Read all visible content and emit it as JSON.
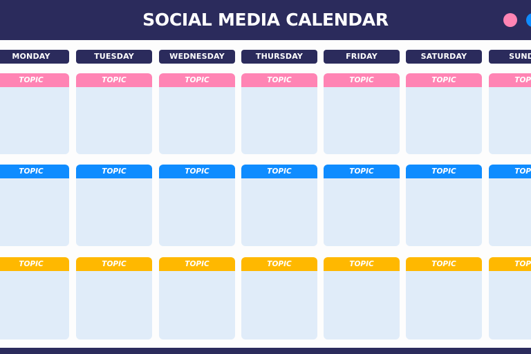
{
  "header": {
    "title": "SOCIAL MEDIA CALENDAR",
    "dots": [
      {
        "name": "pink-dot",
        "color": "#ff84b4"
      },
      {
        "name": "blue-dot",
        "color": "#0f8cff"
      }
    ]
  },
  "colors": {
    "navy": "#2b2b5c",
    "card": "#e0ecf9",
    "pink": "#ff84b4",
    "blue": "#0f8cff",
    "yellow": "#ffb800"
  },
  "days": [
    "MONDAY",
    "TUESDAY",
    "WEDNESDAY",
    "THURSDAY",
    "FRIDAY",
    "SATURDAY",
    "SUNDAY"
  ],
  "rows": [
    {
      "label": "TOPIC",
      "color": "#ff84b4"
    },
    {
      "label": "TOPIC",
      "color": "#0f8cff"
    },
    {
      "label": "TOPIC",
      "color": "#ffb800"
    }
  ]
}
